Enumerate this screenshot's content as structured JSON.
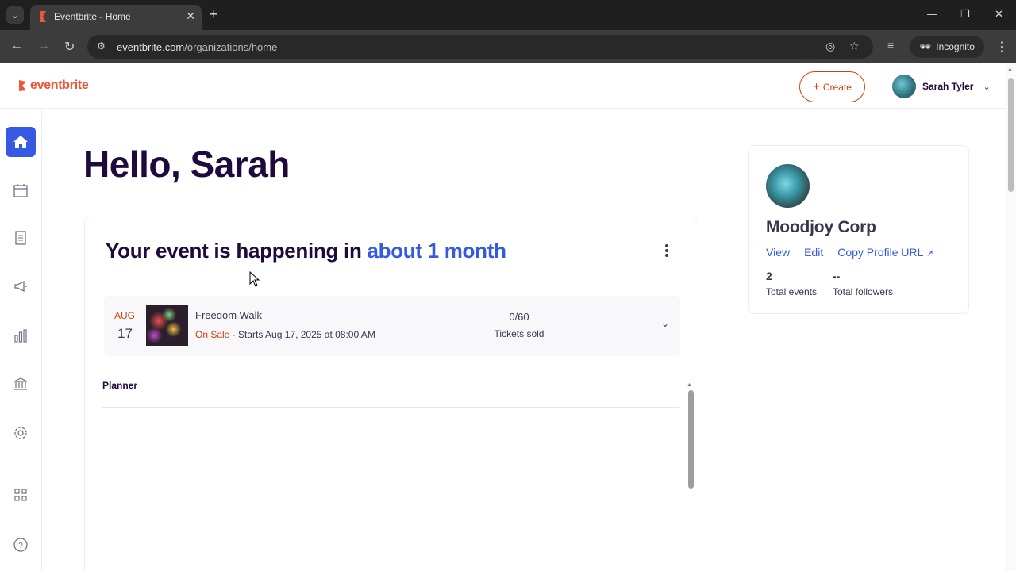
{
  "browser": {
    "tab_title": "Eventbrite - Home",
    "url_domain": "eventbrite.com",
    "url_path": "/organizations/home",
    "incognito_label": "Incognito"
  },
  "header": {
    "logo_text": "eventbrite",
    "create_label": "Create",
    "user_name": "Sarah Tyler"
  },
  "sidebar": {
    "items": [
      {
        "icon": "home-icon",
        "active": true
      },
      {
        "icon": "calendar-icon"
      },
      {
        "icon": "orders-icon"
      },
      {
        "icon": "megaphone-icon"
      },
      {
        "icon": "bar-chart-icon"
      },
      {
        "icon": "bank-icon"
      },
      {
        "icon": "gear-icon"
      },
      {
        "icon": "apps-grid-icon"
      },
      {
        "icon": "help-icon"
      }
    ]
  },
  "main": {
    "greeting": "Hello, Sarah",
    "card_title_prefix": "Your event is happening in ",
    "card_title_highlight": "about 1 month",
    "event": {
      "month": "AUG",
      "day": "17",
      "name": "Freedom Walk",
      "status": "On Sale",
      "starts": " · Starts Aug 17, 2025 at 08:00 AM",
      "tickets_sold": "0/60",
      "tickets_label": "Tickets sold"
    },
    "planner_label": "Planner"
  },
  "org": {
    "name": "Moodjoy Corp",
    "view_label": "View",
    "edit_label": "Edit",
    "copy_label": "Copy Profile URL",
    "total_events_value": "2",
    "total_events_label": "Total events",
    "total_followers_value": "--",
    "total_followers_label": "Total followers"
  },
  "colors": {
    "brand_orange": "#f05537",
    "accent_blue": "#3659e3",
    "text_dark": "#1e0a3c"
  }
}
